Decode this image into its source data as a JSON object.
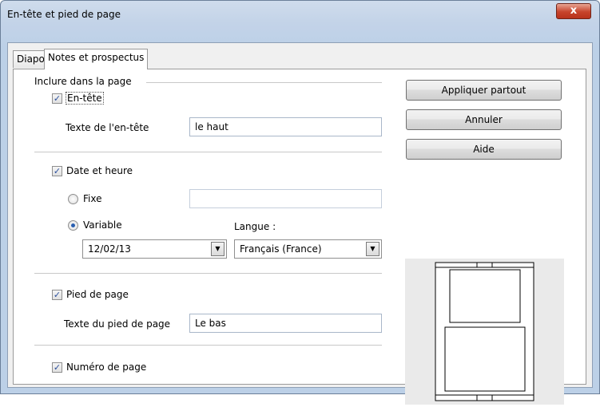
{
  "window": {
    "title": "En-tête et pied de page",
    "close_glyph": "x"
  },
  "tabs": [
    {
      "label": "Diapo",
      "active": false
    },
    {
      "label": "Notes et prospectus",
      "active": true
    }
  ],
  "include": {
    "group_label": "Inclure dans la page",
    "header": {
      "label": "En-tête",
      "checked": true,
      "text_label": "Texte de l'en-tête",
      "text_value": "le haut"
    },
    "datetime": {
      "label": "Date et heure",
      "checked": true,
      "fixed_label": "Fixe",
      "fixed_value": "",
      "variable_label": "Variable",
      "variable_selected": true,
      "format_value": "12/02/13",
      "language_label": "Langue :",
      "language_value": "Français (France)"
    },
    "footer": {
      "label": "Pied de page",
      "checked": true,
      "text_label": "Texte du pied de page",
      "text_value": "Le bas"
    },
    "page_number": {
      "label": "Numéro de page",
      "checked": true
    }
  },
  "buttons": {
    "apply_all": "Appliquer partout",
    "cancel": "Annuler",
    "help": "Aide"
  },
  "icons": {
    "check": "✓",
    "dropdown": "▼"
  }
}
